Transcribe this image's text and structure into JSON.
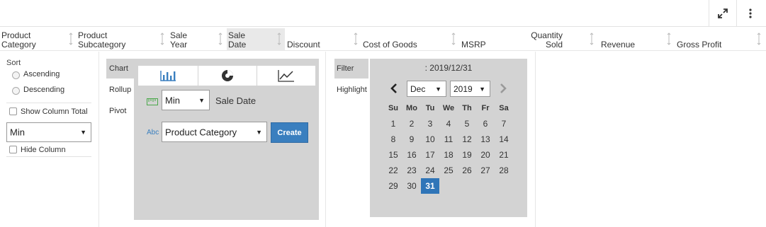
{
  "columns": [
    {
      "label": "Product\nCategory"
    },
    {
      "label": "Product\nSubcategory"
    },
    {
      "label": "Sale\nYear"
    },
    {
      "label": "Sale\nDate"
    },
    {
      "label": "Discount"
    },
    {
      "label": "Cost of Goods"
    },
    {
      "label": "MSRP"
    },
    {
      "label": "Quantity\nSold"
    },
    {
      "label": "Revenue"
    },
    {
      "label": "Gross Profit"
    }
  ],
  "sort": {
    "title": "Sort",
    "ascending": "Ascending",
    "descending": "Descending",
    "show_column_total": "Show Column Total",
    "aggregate": "Min",
    "hide_column": "Hide Column"
  },
  "chart": {
    "tabs": [
      "Chart",
      "Rollup",
      "Pivot"
    ],
    "measure_agg": "Min",
    "measure_field": "Sale Date",
    "dimension": "Product Category",
    "create_label": "Create",
    "icon_types": [
      "bar-chart-icon",
      "pie-chart-icon",
      "line-chart-icon"
    ]
  },
  "filter": {
    "tabs": [
      "Filter",
      "Highlight"
    ],
    "selected_text": ": 2019/12/31",
    "month": "Dec",
    "year": "2019",
    "weekdays": [
      "Su",
      "Mo",
      "Tu",
      "We",
      "Th",
      "Fr",
      "Sa"
    ],
    "weeks": [
      [
        "1",
        "2",
        "3",
        "4",
        "5",
        "6",
        "7"
      ],
      [
        "8",
        "9",
        "10",
        "11",
        "12",
        "13",
        "14"
      ],
      [
        "15",
        "16",
        "17",
        "18",
        "19",
        "20",
        "21"
      ],
      [
        "22",
        "23",
        "24",
        "25",
        "26",
        "27",
        "28"
      ],
      [
        "29",
        "30",
        "31",
        "",
        "",
        "",
        ""
      ]
    ],
    "selected_day": "31"
  },
  "colors": {
    "accent": "#3a7fbf",
    "panel": "#d3d3d3",
    "active_header": "#e9e9e9"
  }
}
